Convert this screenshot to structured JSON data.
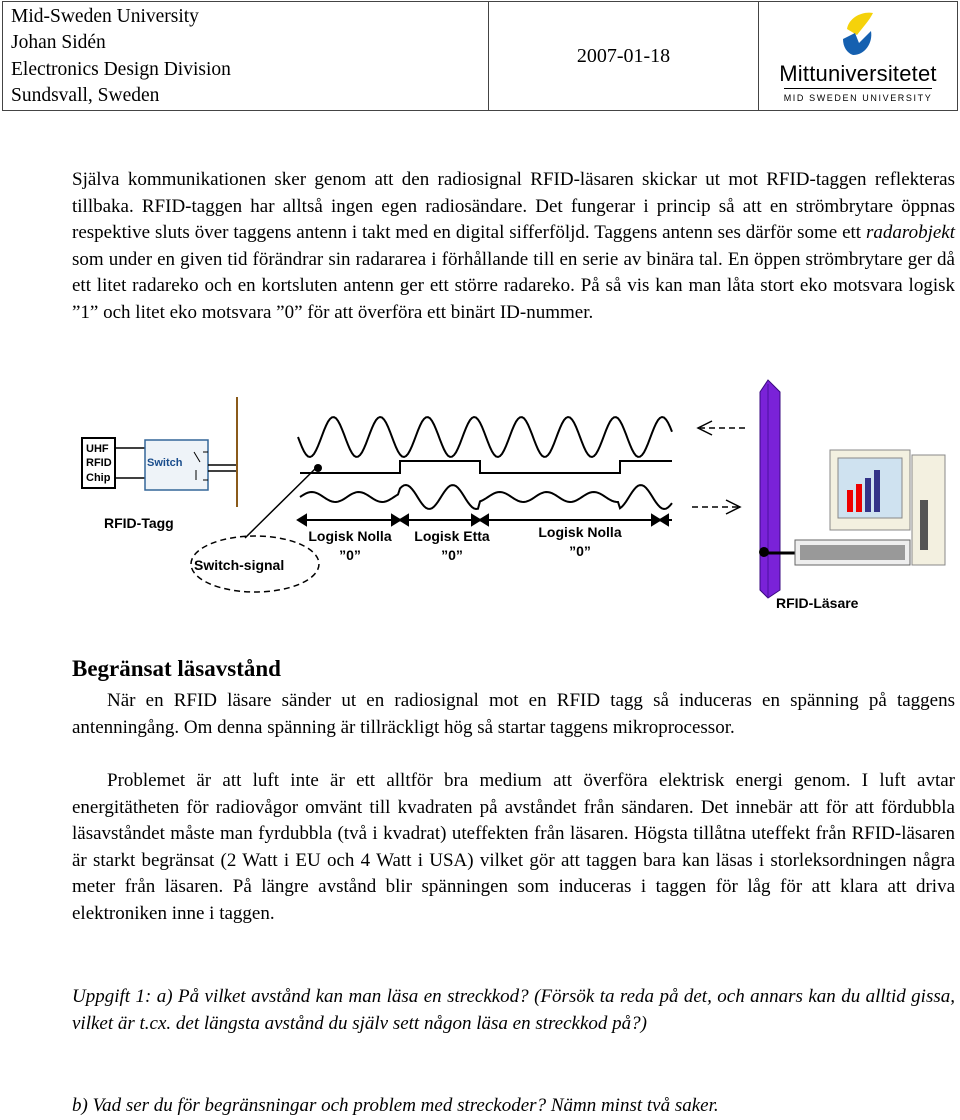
{
  "header": {
    "lines": [
      "Mid-Sweden University",
      "Johan Sidén",
      "Electronics Design Division",
      "Sundsvall, Sweden"
    ],
    "date": "2007-01-18",
    "logo": {
      "name": "Mittuniversitetet",
      "subtitle": "MID SWEDEN UNIVERSITY",
      "colors": [
        "#f5d20a",
        "#1560b0"
      ]
    }
  },
  "intro": {
    "text_before": "Själva kommunikationen sker genom att den radiosignal RFID-läsaren skickar ut mot RFID-taggen reflekteras tillbaka. RFID-taggen har alltså ingen egen radiosändare. Det fungerar i princip så att en strömbrytare öppnas respektive sluts över taggens antenn i takt med en digital sifferföljd. Taggens antenn ses därför some ett ",
    "emphasis": "radarobjekt",
    "text_after": " som under en given tid förändrar sin radararea i förhållande till en serie av binära tal. En öppen strömbrytare ger då ett litet radareko och en kortsluten antenn ger ett större radareko. På så vis kan man låta stort eko motsvara logisk ”1” och litet eko motsvara ”0” för att överföra ett binärt ID-nummer."
  },
  "diagram": {
    "chip_lines": [
      "UHF",
      "RFID",
      "Chip"
    ],
    "switch_label": "Switch",
    "tag_label": "RFID-Tagg",
    "switch_signal": "Switch-signal",
    "segments": [
      {
        "label": "Logisk Nolla",
        "value": "”0”"
      },
      {
        "label": "Logisk Etta",
        "value": "”0”"
      },
      {
        "label": "Logisk Nolla",
        "value": "”0”"
      }
    ],
    "reader_label": "RFID-Läsare",
    "reader_color": "#7a22d8"
  },
  "section": {
    "title": "Begränsat läsavstånd",
    "p1": "När en RFID läsare sänder ut en radiosignal mot en RFID tagg så induceras en spänning på taggens antenningång. Om denna spänning är tillräckligt hög så startar taggens mikroprocessor.",
    "p2": "Problemet är att luft inte är ett alltför bra medium att överföra elektrisk energi genom. I luft avtar energitätheten för radiovågor omvänt till kvadraten på avståndet från sändaren. Det innebär att för att fördubbla läsavståndet måste man fyrdubbla (två i kvadrat) uteffekten från läsaren. Högsta tillåtna uteffekt från RFID-läsaren är starkt begränsat (2 Watt i EU och 4 Watt i USA) vilket gör att taggen bara kan läsas i storleksordningen några meter från läsaren. På längre avstånd blir spänningen som induceras i taggen för låg för att klara att driva elektroniken inne i taggen."
  },
  "task": {
    "a": "Uppgift 1:  a) På vilket avstånd kan man läsa en streckkod?  (Försök ta reda på det, och annars kan du alltid gissa, vilket är t.cx. det längsta avstånd du själv sett någon läsa en streckkod på?)",
    "b": "b) Vad ser du för begränsningar och problem med streckoder? Nämn minst två saker."
  }
}
